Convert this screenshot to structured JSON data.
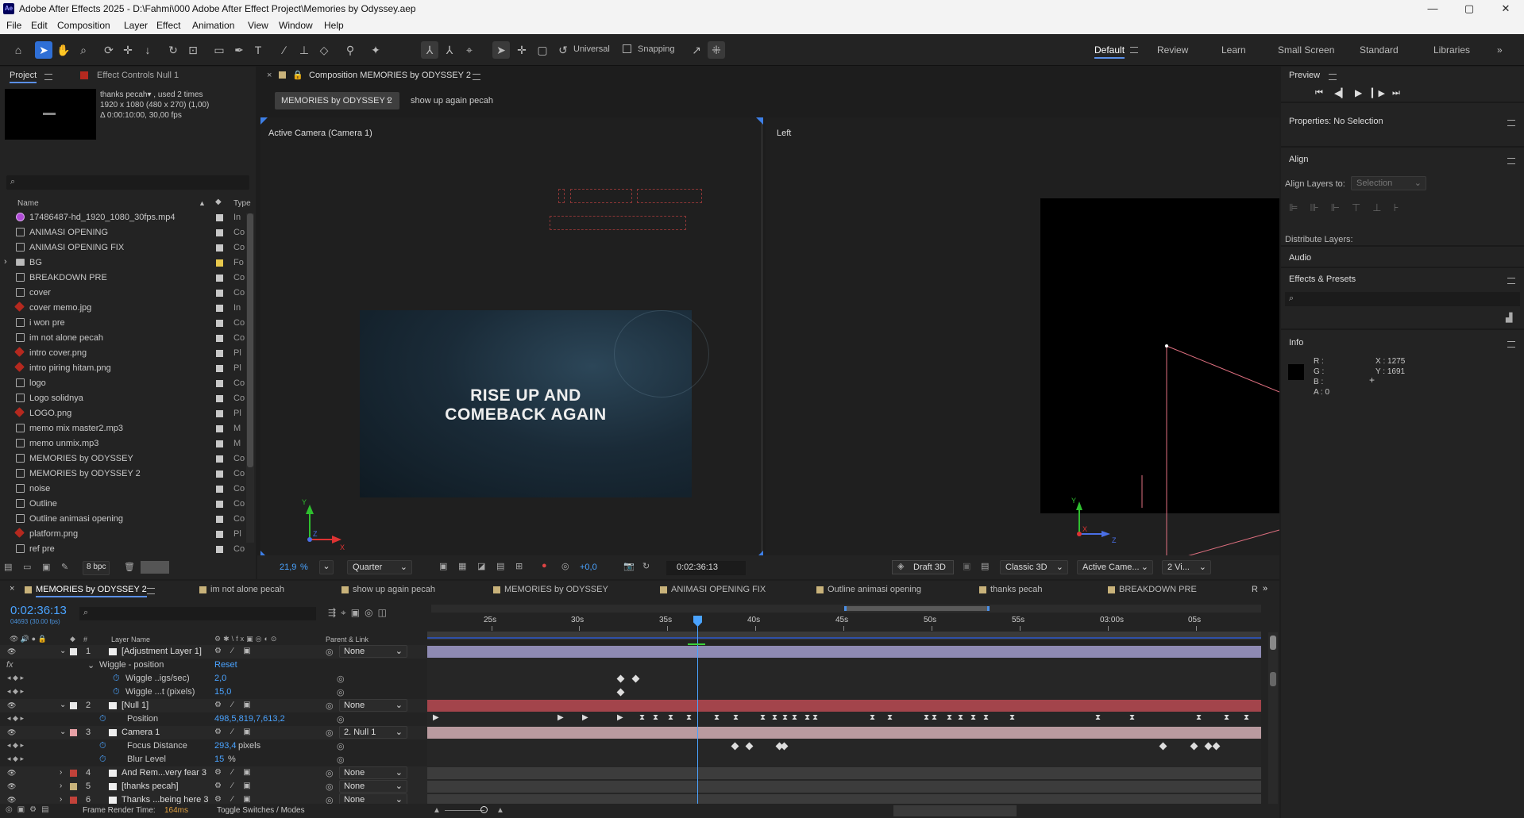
{
  "app": {
    "title": "Adobe After Effects 2025 - D:\\Fahmi\\000 Adobe After Effect Project\\Memories by Odyssey.aep",
    "logo": "Ae"
  },
  "menu": [
    "File",
    "Edit",
    "Composition",
    "Layer",
    "Effect",
    "Animation",
    "View",
    "Window",
    "Help"
  ],
  "toolbar": {
    "universal": "Universal",
    "snapping": "Snapping"
  },
  "workspaces": [
    "Default",
    "Review",
    "Learn",
    "Small Screen",
    "Standard",
    "Libraries"
  ],
  "project": {
    "tab": "Project",
    "effect_tab": "Effect Controls Null 1",
    "info_name": "thanks pecah▾ , used 2 times",
    "info_dim": "1920 x 1080  (480 x 270) (1,00)",
    "info_dur": "Δ 0:00:10:00, 30,00 fps",
    "col_name": "Name",
    "col_type": "Type",
    "items": [
      {
        "name": "17486487-hd_1920_1080_30fps.mp4",
        "type": "In",
        "icon": "video",
        "sw": "#c8c8c8"
      },
      {
        "name": "ANIMASI OPENING",
        "type": "Co",
        "icon": "comp",
        "sw": "#c8c8c8"
      },
      {
        "name": "ANIMASI OPENING FIX",
        "type": "Co",
        "icon": "comp",
        "sw": "#c8c8c8"
      },
      {
        "name": "BG",
        "type": "Fo",
        "icon": "folder",
        "sw": "#e8c94d"
      },
      {
        "name": "BREAKDOWN PRE",
        "type": "Co",
        "icon": "comp",
        "sw": "#c8c8c8"
      },
      {
        "name": "cover",
        "type": "Co",
        "icon": "comp",
        "sw": "#c8c8c8"
      },
      {
        "name": "cover memo.jpg",
        "type": "In",
        "icon": "img",
        "sw": "#c8c8c8"
      },
      {
        "name": "i won pre",
        "type": "Co",
        "icon": "comp",
        "sw": "#c8c8c8"
      },
      {
        "name": "im not alone pecah",
        "type": "Co",
        "icon": "comp",
        "sw": "#c8c8c8"
      },
      {
        "name": "intro cover.png",
        "type": "Pl",
        "icon": "img",
        "sw": "#c8c8c8"
      },
      {
        "name": "intro piring hitam.png",
        "type": "Pl",
        "icon": "img",
        "sw": "#c8c8c8"
      },
      {
        "name": "logo",
        "type": "Co",
        "icon": "comp",
        "sw": "#c8c8c8"
      },
      {
        "name": "Logo solidnya",
        "type": "Co",
        "icon": "comp",
        "sw": "#c8c8c8"
      },
      {
        "name": "LOGO.png",
        "type": "Pl",
        "icon": "img",
        "sw": "#c8c8c8"
      },
      {
        "name": "memo mix master2.mp3",
        "type": "M",
        "icon": "audio",
        "sw": "#c8c8c8"
      },
      {
        "name": "memo unmix.mp3",
        "type": "M",
        "icon": "audio",
        "sw": "#c8c8c8"
      },
      {
        "name": "MEMORIES by ODYSSEY",
        "type": "Co",
        "icon": "comp",
        "sw": "#c8c8c8"
      },
      {
        "name": "MEMORIES by ODYSSEY 2",
        "type": "Co",
        "icon": "comp",
        "sw": "#c8c8c8"
      },
      {
        "name": "noise",
        "type": "Co",
        "icon": "comp",
        "sw": "#c8c8c8"
      },
      {
        "name": "Outline",
        "type": "Co",
        "icon": "comp",
        "sw": "#c8c8c8"
      },
      {
        "name": "Outline animasi opening",
        "type": "Co",
        "icon": "comp",
        "sw": "#c8c8c8"
      },
      {
        "name": "platform.png",
        "type": "Pl",
        "icon": "img",
        "sw": "#c8c8c8"
      },
      {
        "name": "ref pre",
        "type": "Co",
        "icon": "comp",
        "sw": "#c8c8c8"
      }
    ],
    "bpc": "8 bpc"
  },
  "comp": {
    "tab": "Composition MEMORIES by ODYSSEY 2",
    "crumb1": "MEMORIES by ODYSSEY 2",
    "crumb2": "show up again pecah",
    "view1": "Active Camera (Camera 1)",
    "view2": "Left",
    "text_line1": "RISE UP AND",
    "text_line2": "COMEBACK AGAIN",
    "zoom": "21,9",
    "zoom_unit": "%",
    "quality": "Quarter",
    "exposure": "+0,0",
    "timecode": "0:02:36:13",
    "draft": "Draft 3D",
    "renderer": "Classic 3D",
    "camera": "Active Came...",
    "views": "2 Vi..."
  },
  "right": {
    "preview": "Preview",
    "properties": "Properties: No Selection",
    "align": "Align",
    "align_to_label": "Align Layers to:",
    "align_to_value": "Selection",
    "distribute": "Distribute Layers:",
    "audio": "Audio",
    "effects": "Effects & Presets",
    "info": "Info",
    "info_r": "R :",
    "info_g": "G :",
    "info_b": "B :",
    "info_a": "A :  0",
    "info_x": "X : 1275",
    "info_y": "Y : 1691"
  },
  "timeline": {
    "tabs": [
      "MEMORIES by ODYSSEY 2",
      "im not alone pecah",
      "show up again pecah",
      "MEMORIES by ODYSSEY",
      "ANIMASI OPENING FIX",
      "Outline animasi opening",
      "thanks pecah",
      "BREAKDOWN PRE",
      "ref pre",
      "R"
    ],
    "timecode": "0:02:36:13",
    "frames": "04693 (30.00 fps)",
    "col_layer": "Layer Name",
    "col_parent": "Parent & Link",
    "ruler": [
      "25s",
      "30s",
      "35s",
      "40s",
      "45s",
      "50s",
      "55s",
      "03:00s",
      "05s"
    ],
    "rows": [
      {
        "num": "1",
        "name": "[Adjustment Layer 1]",
        "parent": "None",
        "kind": "layer",
        "color": "#e8e8e8"
      },
      {
        "name": "Wiggle - position",
        "value": "Reset",
        "kind": "group"
      },
      {
        "name": "Wiggle ..igs/sec)",
        "value": "2,0",
        "kind": "prop"
      },
      {
        "name": "Wiggle ...t (pixels)",
        "value": "15,0",
        "kind": "prop"
      },
      {
        "num": "2",
        "name": "[Null 1]",
        "parent": "None",
        "kind": "layer",
        "color": "#e8e8e8"
      },
      {
        "name": "Position",
        "value": "498,5,819,7,613,2",
        "kind": "prop"
      },
      {
        "num": "3",
        "name": "Camera 1",
        "parent": "2. Null 1",
        "kind": "layer",
        "color": "#e7a1a6"
      },
      {
        "name": "Focus Distance",
        "value": "293,4",
        "unit": "pixels",
        "kind": "prop"
      },
      {
        "name": "Blur Level",
        "value": "15",
        "unit": "%",
        "kind": "prop"
      },
      {
        "num": "4",
        "name": "And Rem...very fear 3",
        "parent": "None",
        "kind": "layer",
        "color": "#c2423a"
      },
      {
        "num": "5",
        "name": "[thanks pecah]",
        "parent": "None",
        "kind": "layer",
        "color": "#c8b27a"
      },
      {
        "num": "6",
        "name": "Thanks ...being here 3",
        "parent": "None",
        "kind": "layer",
        "color": "#c2423a"
      }
    ],
    "render_label": "Frame Render Time:",
    "render_value": "164ms",
    "toggle": "Toggle Switches / Modes"
  },
  "colors": {
    "accent": "#2f6fd6",
    "playhead": "#4aa3ff",
    "track_adj": "#8e8ab3",
    "track_null": "#a3444b",
    "track_cam": "#b99a9f"
  }
}
